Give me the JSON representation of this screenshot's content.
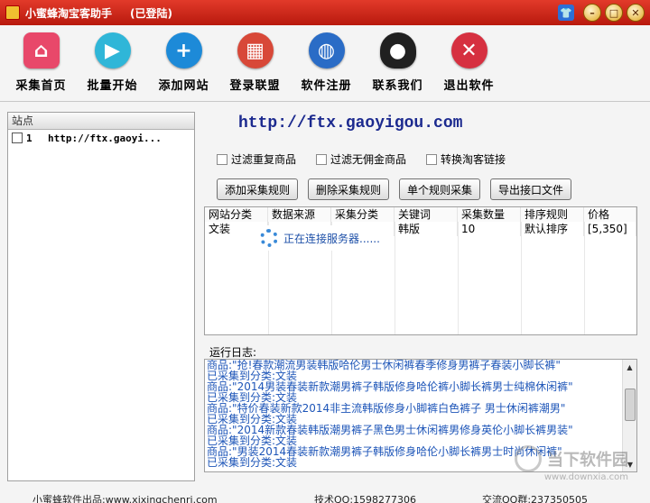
{
  "window": {
    "title": "小蜜蜂淘宝客助手",
    "status": "(已登陆)"
  },
  "toolbar": [
    {
      "label": "采集首页",
      "icon": "home-icon",
      "color": "#e8486a"
    },
    {
      "label": "批量开始",
      "icon": "play-icon",
      "color": "#2fb6d8"
    },
    {
      "label": "添加网站",
      "icon": "plus-icon",
      "color": "#1d8ad8"
    },
    {
      "label": "登录联盟",
      "icon": "brick-icon",
      "color": "#d84838"
    },
    {
      "label": "软件注册",
      "icon": "globe-icon",
      "color": "#2a6cc6"
    },
    {
      "label": "联系我们",
      "icon": "qq-penguin-icon",
      "color": "#202020"
    },
    {
      "label": "退出软件",
      "icon": "close-icon",
      "color": "#d63040"
    }
  ],
  "site_panel": {
    "header": "站点",
    "items": [
      {
        "num": "1",
        "url": "http://ftx.gaoyi..."
      }
    ]
  },
  "main": {
    "url": "http://ftx.gaoyigou.com",
    "options": [
      "过滤重复商品",
      "过滤无佣金商品",
      "转换淘客链接"
    ],
    "buttons": [
      "添加采集规则",
      "删除采集规则",
      "单个规则采集",
      "导出接口文件"
    ],
    "grid": {
      "columns": [
        "网站分类",
        "数据来源",
        "采集分类",
        "关键词",
        "采集数量",
        "排序规则",
        "价格"
      ],
      "rows": [
        [
          "文装",
          "",
          "",
          "韩版",
          "10",
          "默认排序",
          "[5,350]"
        ]
      ]
    },
    "loading": "正在连接服务器......",
    "log_label": "运行日志:",
    "log": [
      "商品:\"抢!春款潮流男装韩版哈伦男士休闲裤春季修身男裤子春装小脚长裤\"",
      "已采集到分类:文装",
      "商品:\"2014男装春装新款潮男裤子韩版修身哈伦裤小脚长裤男士纯棉休闲裤\"",
      "已采集到分类:文装",
      "商品:\"特价春装新款2014非主流韩版修身小脚裤白色裤子 男士休闲裤潮男\"",
      "已采集到分类:文装",
      "商品:\"2014新款春装韩版潮男裤子黑色男士休闲裤男修身英伦小脚长裤男装\"",
      "已采集到分类:文装",
      "商品:\"男装2014春装新款潮男裤子韩版修身哈伦小脚长裤男士时尚休闲裤\"",
      "已采集到分类:文装"
    ]
  },
  "status_bar": {
    "publisher": "小蜜蜂软件出品:www.xixingchenri.com",
    "tech": "技术QQ:1598277306",
    "group": "交流QQ群:237350505"
  },
  "watermark": {
    "text": "当下软件园",
    "sub": "www.downxia.com"
  }
}
